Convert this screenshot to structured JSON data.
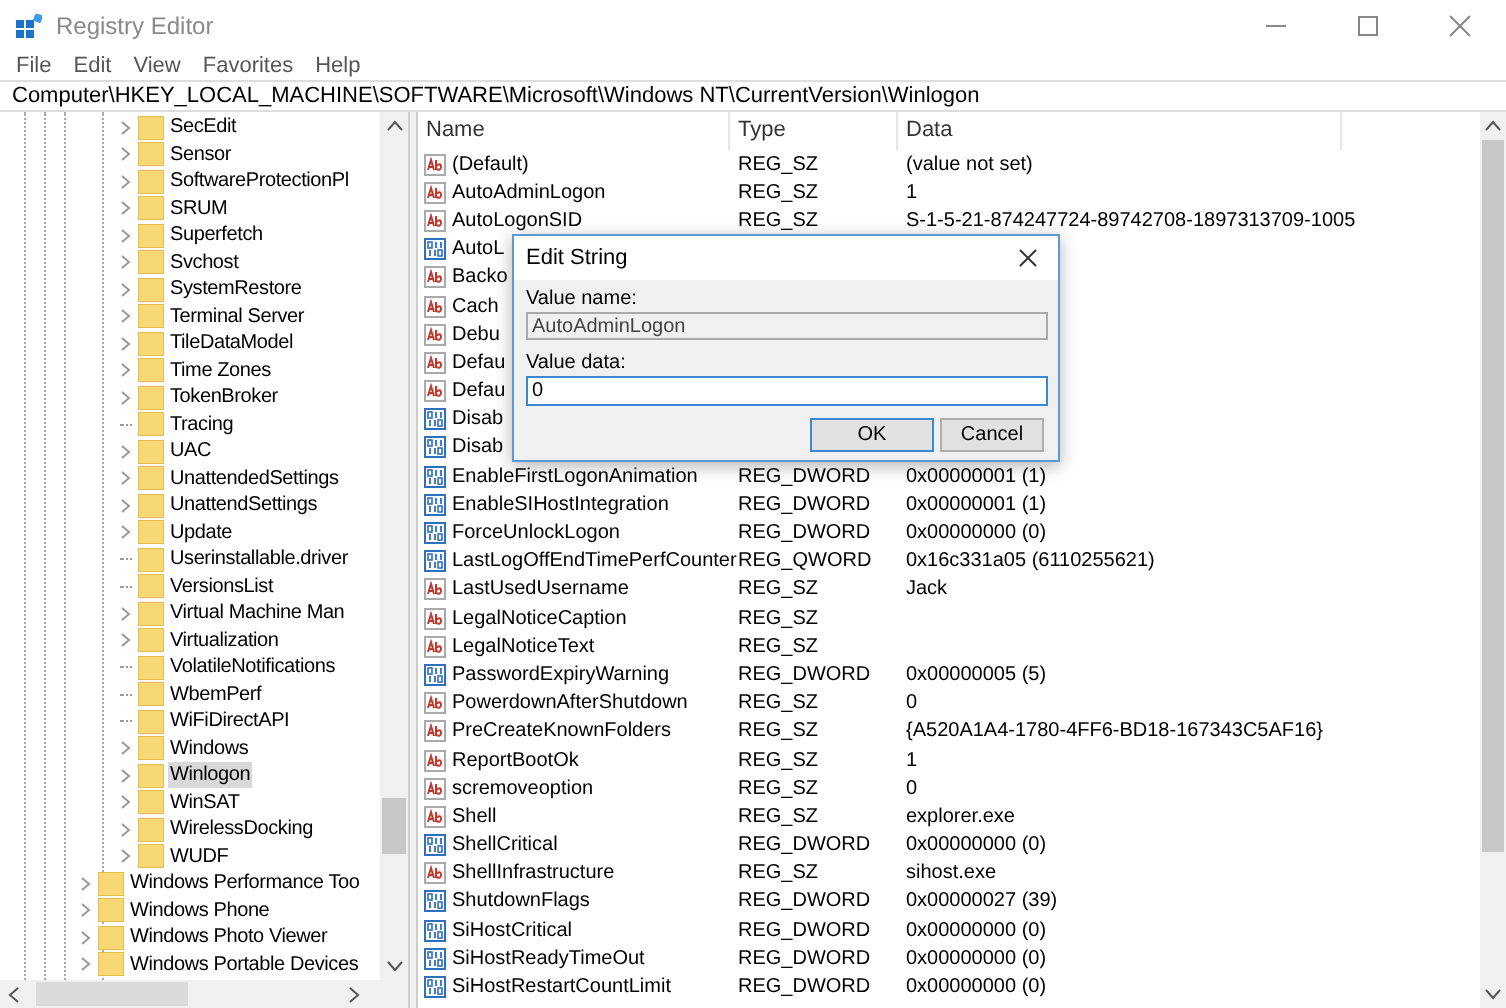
{
  "window": {
    "title": "Registry Editor"
  },
  "menu": [
    "File",
    "Edit",
    "View",
    "Favorites",
    "Help"
  ],
  "address": "Computer\\HKEY_LOCAL_MACHINE\\SOFTWARE\\Microsoft\\Windows NT\\CurrentVersion\\Winlogon",
  "tree": {
    "items": [
      {
        "children": [
          {
            "label": "SecEdit",
            "expandable": true,
            "selected": false
          },
          {
            "label": "Sensor",
            "expandable": true,
            "selected": false
          },
          {
            "label": "SoftwareProtectionPl",
            "expandable": true,
            "selected": false
          },
          {
            "label": "SRUM",
            "expandable": true,
            "selected": false
          },
          {
            "label": "Superfetch",
            "expandable": true,
            "selected": false
          },
          {
            "label": "Svchost",
            "expandable": true,
            "selected": false
          },
          {
            "label": "SystemRestore",
            "expandable": true,
            "selected": false
          },
          {
            "label": "Terminal Server",
            "expandable": true,
            "selected": false
          },
          {
            "label": "TileDataModel",
            "expandable": true,
            "selected": false
          },
          {
            "label": "Time Zones",
            "expandable": true,
            "selected": false
          },
          {
            "label": "TokenBroker",
            "expandable": true,
            "selected": false
          },
          {
            "label": "Tracing",
            "expandable": false,
            "selected": false
          },
          {
            "label": "UAC",
            "expandable": true,
            "selected": false
          },
          {
            "label": "UnattendedSettings",
            "expandable": true,
            "selected": false
          },
          {
            "label": "UnattendSettings",
            "expandable": true,
            "selected": false
          },
          {
            "label": "Update",
            "expandable": true,
            "selected": false
          },
          {
            "label": "Userinstallable.driver",
            "expandable": false,
            "selected": false
          },
          {
            "label": "VersionsList",
            "expandable": false,
            "selected": false
          },
          {
            "label": "Virtual Machine Man",
            "expandable": true,
            "selected": false
          },
          {
            "label": "Virtualization",
            "expandable": true,
            "selected": false
          },
          {
            "label": "VolatileNotifications",
            "expandable": false,
            "selected": false
          },
          {
            "label": "WbemPerf",
            "expandable": false,
            "selected": false
          },
          {
            "label": "WiFiDirectAPI",
            "expandable": false,
            "selected": false
          },
          {
            "label": "Windows",
            "expandable": true,
            "selected": false
          },
          {
            "label": "Winlogon",
            "expandable": true,
            "selected": true
          },
          {
            "label": "WinSAT",
            "expandable": true,
            "selected": false
          },
          {
            "label": "WirelessDocking",
            "expandable": true,
            "selected": false
          },
          {
            "label": "WUDF",
            "expandable": true,
            "selected": false
          }
        ]
      },
      {
        "label": "Windows Performance Too",
        "expandable": true,
        "selected": false
      },
      {
        "label": "Windows Phone",
        "expandable": true,
        "selected": false
      },
      {
        "label": "Windows Photo Viewer",
        "expandable": true,
        "selected": false
      },
      {
        "label": "Windows Portable Devices",
        "expandable": true,
        "selected": false
      }
    ]
  },
  "values": {
    "columns": [
      "Name",
      "Type",
      "Data"
    ],
    "rows": [
      {
        "kind": "sz",
        "name": "(Default)",
        "type": "REG_SZ",
        "data": "(value not set)"
      },
      {
        "kind": "sz",
        "name": "AutoAdminLogon",
        "type": "REG_SZ",
        "data": "1"
      },
      {
        "kind": "sz",
        "name": "AutoLogonSID",
        "type": "REG_SZ",
        "data": "S-1-5-21-874247724-89742708-1897313709-1005"
      },
      {
        "kind": "bin",
        "name": "AutoL"
      },
      {
        "kind": "sz",
        "name": "Backo"
      },
      {
        "kind": "sz",
        "name": "Cach"
      },
      {
        "kind": "sz",
        "name": "Debu"
      },
      {
        "kind": "sz",
        "name": "Defau"
      },
      {
        "kind": "sz",
        "name": "Defau"
      },
      {
        "kind": "bin",
        "name": "Disab"
      },
      {
        "kind": "bin",
        "name": "Disab"
      },
      {
        "kind": "bin",
        "name": "EnableFirstLogonAnimation",
        "type": "REG_DWORD",
        "data": "0x00000001 (1)"
      },
      {
        "kind": "bin",
        "name": "EnableSIHostIntegration",
        "type": "REG_DWORD",
        "data": "0x00000001 (1)"
      },
      {
        "kind": "bin",
        "name": "ForceUnlockLogon",
        "type": "REG_DWORD",
        "data": "0x00000000 (0)"
      },
      {
        "kind": "bin",
        "name": "LastLogOffEndTimePerfCounter",
        "type": "REG_QWORD",
        "data": "0x16c331a05 (6110255621)"
      },
      {
        "kind": "sz",
        "name": "LastUsedUsername",
        "type": "REG_SZ",
        "data": "Jack"
      },
      {
        "kind": "sz",
        "name": "LegalNoticeCaption",
        "type": "REG_SZ"
      },
      {
        "kind": "sz",
        "name": "LegalNoticeText",
        "type": "REG_SZ"
      },
      {
        "kind": "bin",
        "name": "PasswordExpiryWarning",
        "type": "REG_DWORD",
        "data": "0x00000005 (5)"
      },
      {
        "kind": "sz",
        "name": "PowerdownAfterShutdown",
        "type": "REG_SZ",
        "data": "0"
      },
      {
        "kind": "sz",
        "name": "PreCreateKnownFolders",
        "type": "REG_SZ",
        "data": "{A520A1A4-1780-4FF6-BD18-167343C5AF16}"
      },
      {
        "kind": "sz",
        "name": "ReportBootOk",
        "type": "REG_SZ",
        "data": "1"
      },
      {
        "kind": "sz",
        "name": "scremoveoption",
        "type": "REG_SZ",
        "data": "0"
      },
      {
        "kind": "sz",
        "name": "Shell",
        "type": "REG_SZ",
        "data": "explorer.exe"
      },
      {
        "kind": "bin",
        "name": "ShellCritical",
        "type": "REG_DWORD",
        "data": "0x00000000 (0)"
      },
      {
        "kind": "sz",
        "name": "ShellInfrastructure",
        "type": "REG_SZ",
        "data": "sihost.exe"
      },
      {
        "kind": "bin",
        "name": "ShutdownFlags",
        "type": "REG_DWORD",
        "data": "0x00000027 (39)"
      },
      {
        "kind": "bin",
        "name": "SiHostCritical",
        "type": "REG_DWORD",
        "data": "0x00000000 (0)"
      },
      {
        "kind": "bin",
        "name": "SiHostReadyTimeOut",
        "type": "REG_DWORD",
        "data": "0x00000000 (0)"
      },
      {
        "kind": "bin",
        "name": "SiHostRestartCountLimit",
        "type": "REG_DWORD",
        "data": "0x00000000 (0)"
      }
    ]
  },
  "dialog": {
    "title": "Edit String",
    "name_label": "Value name:",
    "name_value": "AutoAdminLogon",
    "data_label": "Value data:",
    "data_value": "0",
    "buttons": [
      {
        "label": "OK",
        "default": true
      },
      {
        "label": "Cancel",
        "default": false
      }
    ]
  }
}
